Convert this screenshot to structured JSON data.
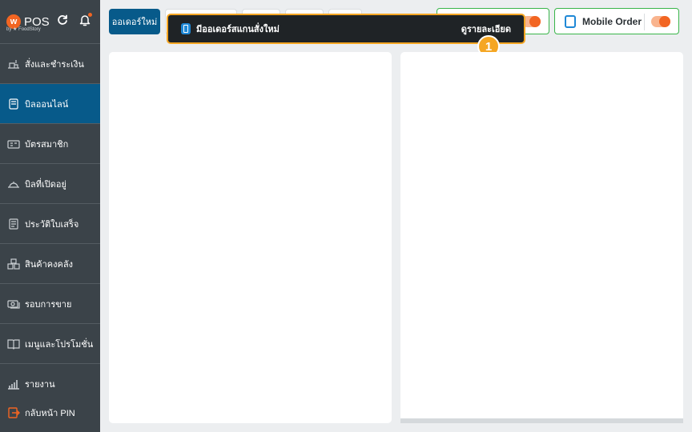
{
  "brand": {
    "logo_letter": "w",
    "name": "POS",
    "subtitle": "by ★ FoodStory"
  },
  "header_icons": [
    "refresh-icon",
    "bell-icon"
  ],
  "sidebar": {
    "items": [
      {
        "label": "สั่งและชำระเงิน",
        "icon": "order-pay-icon",
        "active": false
      },
      {
        "label": "บิลออนไลน์",
        "icon": "online-bill-icon",
        "active": true
      },
      {
        "label": "บัตรสมาชิก",
        "icon": "member-card-icon",
        "active": false
      },
      {
        "label": "บิลที่เปิดอยู่",
        "icon": "open-bill-icon",
        "active": false
      },
      {
        "label": "ประวัติใบเสร็จ",
        "icon": "receipt-history-icon",
        "active": false
      },
      {
        "label": "สินค้าคงคลัง",
        "icon": "inventory-icon",
        "active": false
      },
      {
        "label": "รอบการขาย",
        "icon": "sales-round-icon",
        "active": false
      },
      {
        "label": "เมนูและโปรโมชั่น",
        "icon": "menu-promo-icon",
        "active": false
      },
      {
        "label": "รายงาน",
        "icon": "report-icon",
        "active": false
      }
    ],
    "logout_label": "กลับหน้า PIN"
  },
  "topbar": {
    "new_order_label": "ออเดอร์ใหม่",
    "mobile_order_label": "Mobile Order",
    "mobile_order_enabled": true
  },
  "toast": {
    "message": "มีออเดอร์สแกนสั่งใหม่",
    "link_label": "ดูรายละเอียด",
    "badge_number": "1"
  },
  "colors": {
    "sidebar_bg": "#3b4349",
    "active_bg": "#075a8a",
    "accent_orange": "#f26522",
    "highlight_yellow": "#f5a623",
    "toggle_border_green": "#39b54a"
  }
}
